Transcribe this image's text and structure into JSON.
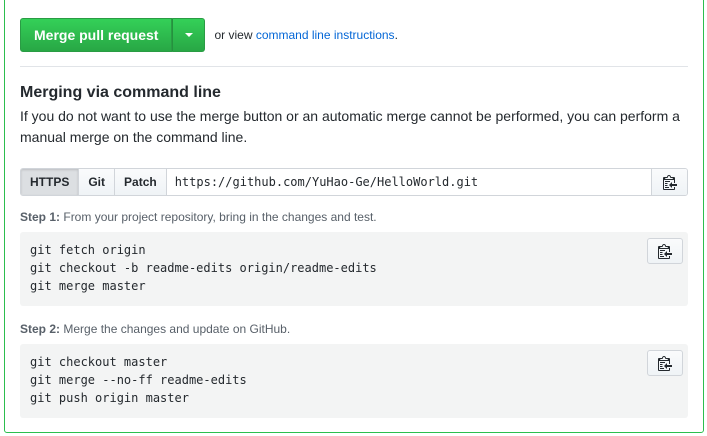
{
  "merge": {
    "button_label": "Merge pull request",
    "alt_prefix": "or view",
    "alt_link": "command line instructions",
    "alt_suffix": "."
  },
  "cli": {
    "heading": "Merging via command line",
    "description": "If you do not want to use the merge button or an automatic merge cannot be performed, you can perform a manual merge on the command line."
  },
  "clone": {
    "protocols": [
      "HTTPS",
      "Git",
      "Patch"
    ],
    "selected": "HTTPS",
    "url": "https://github.com/YuHao-Ge/HelloWorld.git"
  },
  "steps": [
    {
      "label": "Step 1:",
      "text": "From your project repository, bring in the changes and test.",
      "commands": [
        "git fetch origin",
        "git checkout -b readme-edits origin/readme-edits",
        "git merge master"
      ]
    },
    {
      "label": "Step 2:",
      "text": "Merge the changes and update on GitHub.",
      "commands": [
        "git checkout master",
        "git merge --no-ff readme-edits",
        "git push origin master"
      ]
    }
  ],
  "icons": {
    "dropdown": "caret-down-icon",
    "copy": "clippy-icon"
  },
  "colors": {
    "merge_green": "#28a745",
    "link_blue": "#0366d6",
    "frame_green": "#2cbe4e"
  }
}
